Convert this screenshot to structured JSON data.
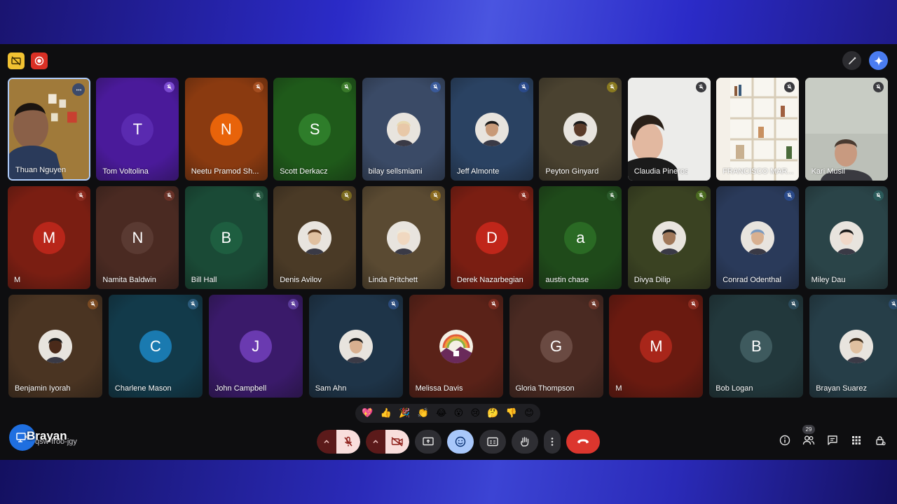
{
  "self": {
    "name": "Brayan",
    "meeting_code": "qsw-froo-jgy"
  },
  "participants_count": "29",
  "colors": {
    "bg_dark": "#0e0e10",
    "accent_blue": "#a8c7fa",
    "end_call": "#dc362e"
  },
  "reactions": [
    "💖",
    "👍",
    "🎉",
    "👏",
    "😂",
    "😮",
    "😢",
    "🤔",
    "👎",
    "😊"
  ],
  "tiles": [
    {
      "name": "Thuan Nguyen",
      "type": "video",
      "bg": "#6b5a2a",
      "speaking": true
    },
    {
      "name": "Tom Voltolina",
      "type": "letter",
      "letter": "T",
      "bg": "#4a1a9a",
      "circle": "#5a2ab0",
      "mic": "#7a4ad0"
    },
    {
      "name": "Neetu Pramod Sh...",
      "type": "letter",
      "letter": "N",
      "bg": "#8a3a10",
      "circle": "#e8630a",
      "mic": "#a54e20"
    },
    {
      "name": "Scott Derkacz",
      "type": "letter",
      "letter": "S",
      "bg": "#1f5a1a",
      "circle": "#2e7d2a",
      "mic": "#3a7a2a"
    },
    {
      "name": "bilay sellsmiami",
      "type": "photo",
      "bg": "#3a4a66",
      "mic": "#3a5a9a",
      "skin": "#e8c8a8",
      "hair": "#e8d8b0"
    },
    {
      "name": "Jeff Almonte",
      "type": "photo",
      "bg": "#2a4262",
      "mic": "#2a4a8a",
      "skin": "#c89a78",
      "hair": "#1a1a1a"
    },
    {
      "name": "Peyton Ginyard",
      "type": "photo",
      "bg": "#4a4230",
      "mic": "#8a7a20",
      "skin": "#5a3a28",
      "hair": "#1a1a1a"
    },
    {
      "name": "Claudia Pineros",
      "type": "video",
      "bg": "#e6e6e6"
    },
    {
      "name": "FRANCISCO MAR...",
      "type": "video",
      "bg": "#d8d0c0"
    },
    {
      "name": "Kari Musil",
      "type": "video",
      "bg": "#c0c4bc"
    },
    {
      "name": "M",
      "type": "letter",
      "letter": "M",
      "bg": "#7a1e12",
      "circle": "#b8261a",
      "mic": "#8a2a1e"
    },
    {
      "name": "Namita Baldwin",
      "type": "letter",
      "letter": "N",
      "bg": "#4a2a22",
      "circle": "#5a3a32",
      "mic": "#6a3228"
    },
    {
      "name": "Bill Hall",
      "type": "letter",
      "letter": "B",
      "bg": "#1a4a36",
      "circle": "#1e5e40",
      "mic": "#2a5a44"
    },
    {
      "name": "Denis Avilov",
      "type": "photo",
      "bg": "#4a3a26",
      "mic": "#7a6a20",
      "skin": "#e0c0a0",
      "hair": "#5a3a20"
    },
    {
      "name": "Linda Pritchett",
      "type": "photo",
      "bg": "#5a4a32",
      "mic": "#8a6a20",
      "skin": "#f0d8c0",
      "hair": "#f0e8d8"
    },
    {
      "name": "Derek Nazarbegian",
      "type": "letter",
      "letter": "D",
      "bg": "#7a1e12",
      "circle": "#c0261a",
      "mic": "#8a2a1e"
    },
    {
      "name": "austin chase",
      "type": "letter",
      "letter": "a",
      "bg": "#1f4a1a",
      "circle": "#2a6a24",
      "mic": "#2a5a2a"
    },
    {
      "name": "Divya Dilip",
      "type": "photo",
      "bg": "#3a4222",
      "mic": "#4a6a20",
      "skin": "#a0785a",
      "hair": "#1a1a1a"
    },
    {
      "name": "Conrad Odenthal",
      "type": "photo",
      "bg": "#2a3a5a",
      "mic": "#2a4a8a",
      "skin": "#d8b090",
      "hair": "#7a9ac0"
    },
    {
      "name": "Miley Dau",
      "type": "photo",
      "bg": "#2a4448",
      "mic": "#2a5a5a",
      "skin": "#f0d8c8",
      "hair": "#1a1a1a"
    },
    {
      "name": "Benjamin Iyorah",
      "type": "photo",
      "bg": "#4a3422",
      "mic": "#7a4a22",
      "skin": "#4a2a1a",
      "hair": "#1a1a1a"
    },
    {
      "name": "Charlene Mason",
      "type": "letter",
      "letter": "C",
      "bg": "#123a4a",
      "circle": "#1a7ab0",
      "mic": "#2a5a7a"
    },
    {
      "name": "John Campbell",
      "type": "letter",
      "letter": "J",
      "bg": "#3a1a6a",
      "circle": "#6a3ab0",
      "mic": "#5a3a9a"
    },
    {
      "name": "Sam Ahn",
      "type": "photo",
      "bg": "#1e3448",
      "mic": "#2a4a7a",
      "skin": "#d8b090",
      "hair": "#1a1a1a"
    },
    {
      "name": "Melissa Davis",
      "type": "logo",
      "bg": "#5a2218",
      "mic": "#7a2a1e"
    },
    {
      "name": "Gloria Thompson",
      "type": "letter",
      "letter": "G",
      "bg": "#4a2a22",
      "circle": "#6a4a42",
      "mic": "#6a3428"
    },
    {
      "name": "M",
      "type": "letter",
      "letter": "M",
      "bg": "#6a1a10",
      "circle": "#a8261a",
      "mic": "#8a2a1e"
    },
    {
      "name": "Bob Logan",
      "type": "letter",
      "letter": "B",
      "bg": "#22383c",
      "circle": "#3e5a5e",
      "mic": "#2a4a5a"
    },
    {
      "name": "Brayan Suarez",
      "type": "photo",
      "bg": "#263e48",
      "mic": "#2a4a6a",
      "skin": "#e0c0a0",
      "hair": "#3a2a1a"
    }
  ]
}
